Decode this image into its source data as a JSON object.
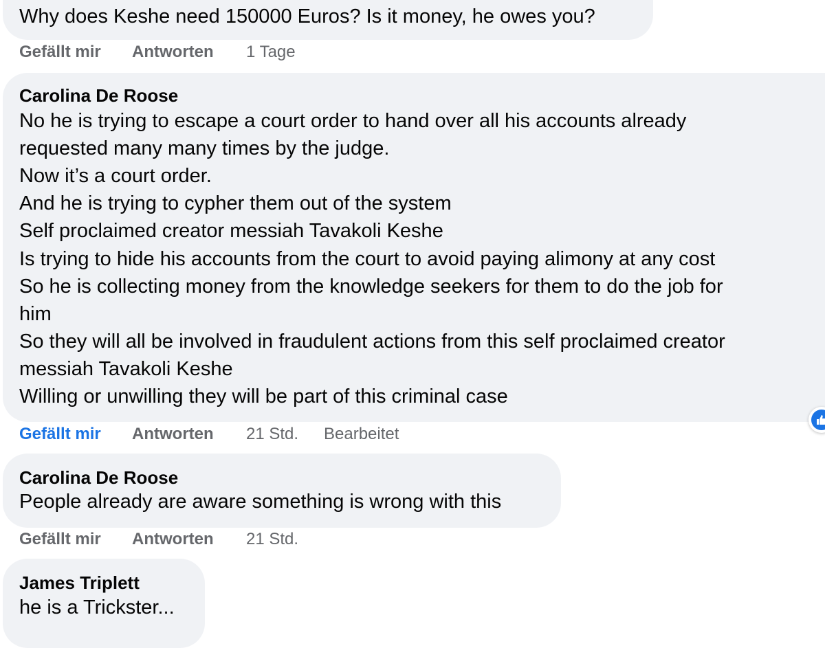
{
  "comments": [
    {
      "body": [
        "Why does Keshe need 150000 Euros? Is it money, he owes you?"
      ],
      "actions": {
        "like": "Gefällt mir",
        "reply": "Antworten",
        "time": "1 Tage"
      }
    },
    {
      "author": "Carolina De Roose",
      "body": [
        "No he is trying to escape a court order to hand over all his accounts already",
        "requested many many times by the judge.",
        "Now it’s a court order.",
        "And he is trying to cypher them out of the system",
        "Self proclaimed creator messiah Tavakoli Keshe",
        "Is trying to hide his accounts from the court to avoid paying alimony at any cost",
        "So he is collecting money from the knowledge seekers for them to do the job for",
        "him",
        "So they will all be involved in fraudulent actions from this self proclaimed creator",
        "messiah Tavakoli Keshe",
        "Willing or unwilling they will be part of this criminal case"
      ],
      "actions": {
        "like": "Gefällt mir",
        "reply": "Antworten",
        "time": "21 Std.",
        "edited": "Bearbeitet"
      }
    },
    {
      "author": "Carolina De Roose",
      "body": [
        "People already are aware something is wrong with this"
      ],
      "actions": {
        "like": "Gefällt mir",
        "reply": "Antworten",
        "time": "21 Std."
      }
    },
    {
      "author": "James Triplett",
      "body": [
        "he is a Trickster..."
      ]
    }
  ],
  "icons": {
    "reaction": "like-reaction-icon"
  },
  "colors": {
    "bubble": "#f0f2f5",
    "liked": "#1b74e4",
    "meta": "#65676b"
  }
}
